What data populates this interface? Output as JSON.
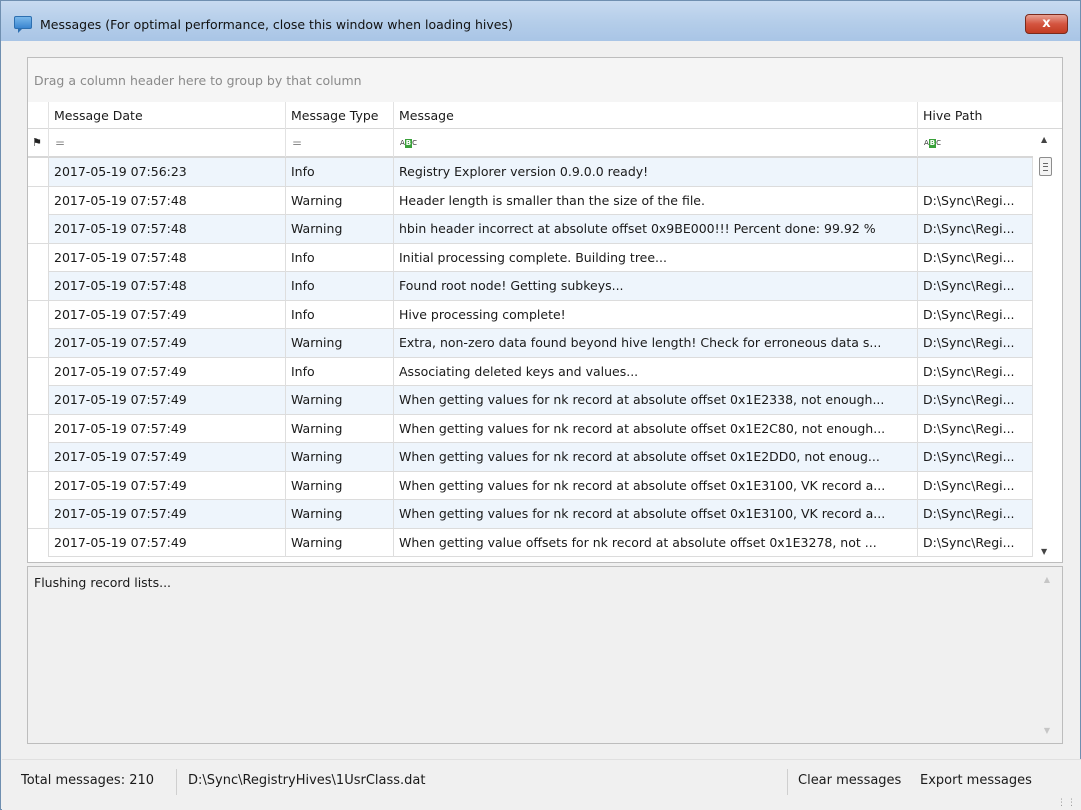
{
  "window": {
    "title": "Messages (For optimal performance, close this window when loading hives)",
    "close_label": "x"
  },
  "grid": {
    "group_panel_text": "Drag a column header here to group by that column",
    "columns": [
      "Message Date",
      "Message Type",
      "Message",
      "Hive Path"
    ],
    "filter_row": {
      "date_op": "=",
      "type_op": "=",
      "message_op": "ABC",
      "hive_op": "ABC",
      "pin_icon": "pin-icon"
    },
    "rows": [
      {
        "date": "2017-05-19 07:56:23",
        "type": "Info",
        "message": "Registry Explorer version 0.9.0.0 ready!",
        "hive": ""
      },
      {
        "date": "2017-05-19 07:57:48",
        "type": "Warning",
        "message": "Header length is smaller than the size of the file.",
        "hive": "D:\\Sync\\Regi..."
      },
      {
        "date": "2017-05-19 07:57:48",
        "type": "Warning",
        "message": "hbin header incorrect at absolute offset 0x9BE000!!! Percent done: 99.92 %",
        "hive": "D:\\Sync\\Regi..."
      },
      {
        "date": "2017-05-19 07:57:48",
        "type": "Info",
        "message": "Initial processing complete. Building tree...",
        "hive": "D:\\Sync\\Regi..."
      },
      {
        "date": "2017-05-19 07:57:48",
        "type": "Info",
        "message": "Found root node! Getting subkeys...",
        "hive": "D:\\Sync\\Regi..."
      },
      {
        "date": "2017-05-19 07:57:49",
        "type": "Info",
        "message": "Hive processing complete!",
        "hive": "D:\\Sync\\Regi..."
      },
      {
        "date": "2017-05-19 07:57:49",
        "type": "Warning",
        "message": "Extra, non-zero data found beyond hive length! Check for erroneous data s...",
        "hive": "D:\\Sync\\Regi..."
      },
      {
        "date": "2017-05-19 07:57:49",
        "type": "Info",
        "message": "Associating deleted keys and values...",
        "hive": "D:\\Sync\\Regi..."
      },
      {
        "date": "2017-05-19 07:57:49",
        "type": "Warning",
        "message": "When getting values for nk record at absolute offset 0x1E2338, not enough...",
        "hive": "D:\\Sync\\Regi..."
      },
      {
        "date": "2017-05-19 07:57:49",
        "type": "Warning",
        "message": "When getting values for nk record at absolute offset 0x1E2C80, not enough...",
        "hive": "D:\\Sync\\Regi..."
      },
      {
        "date": "2017-05-19 07:57:49",
        "type": "Warning",
        "message": "When getting values for nk record at absolute offset 0x1E2DD0, not enoug...",
        "hive": "D:\\Sync\\Regi..."
      },
      {
        "date": "2017-05-19 07:57:49",
        "type": "Warning",
        "message": "When getting values for nk record at absolute offset 0x1E3100, VK record a...",
        "hive": "D:\\Sync\\Regi..."
      },
      {
        "date": "2017-05-19 07:57:49",
        "type": "Warning",
        "message": "When getting values for nk record at absolute offset 0x1E3100, VK record a...",
        "hive": "D:\\Sync\\Regi..."
      },
      {
        "date": "2017-05-19 07:57:49",
        "type": "Warning",
        "message": "When getting value offsets for nk record at absolute offset 0x1E3278, not ...",
        "hive": "D:\\Sync\\Regi..."
      }
    ]
  },
  "detail": {
    "text": "Flushing record lists..."
  },
  "status": {
    "total": "Total messages: 210",
    "hive_path": "D:\\Sync\\RegistryHives\\1UsrClass.dat",
    "clear_label": "Clear messages",
    "export_label": "Export messages"
  }
}
